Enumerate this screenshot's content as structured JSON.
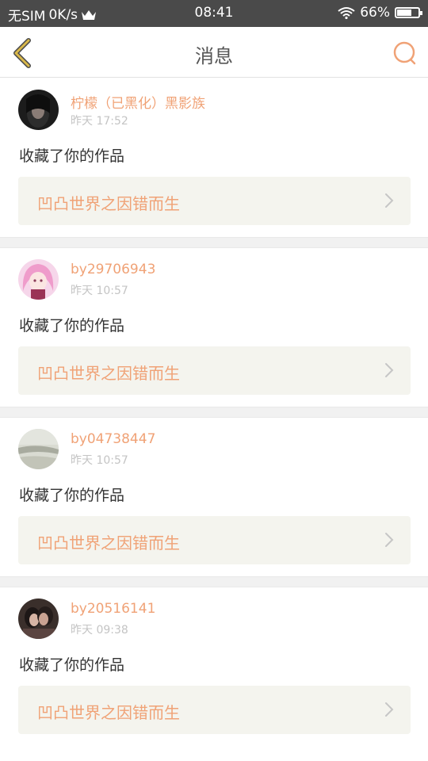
{
  "status_bar": {
    "carrier": "无SIM",
    "speed": "0K/s",
    "time": "08:41",
    "battery": "66%",
    "battery_level": 0.66
  },
  "nav": {
    "title": "消息",
    "back_icon": "back-chevron-icon",
    "search_icon": "search-icon"
  },
  "colors": {
    "accent": "#f0a276",
    "back_yellow": "#d9b84a",
    "card_box": "#f4f4ee"
  },
  "messages": [
    {
      "user": "柠檬（已黑化）黑影族",
      "time": "昨天 17:52",
      "action": "收藏了你的作品",
      "work": "凹凸世界之因错而生"
    },
    {
      "user": "by29706943",
      "time": "昨天 10:57",
      "action": "收藏了你的作品",
      "work": "凹凸世界之因错而生"
    },
    {
      "user": "by04738447",
      "time": "昨天 10:57",
      "action": "收藏了你的作品",
      "work": "凹凸世界之因错而生"
    },
    {
      "user": "by20516141",
      "time": "昨天 09:38",
      "action": "收藏了你的作品",
      "work": "凹凸世界之因错而生"
    }
  ]
}
